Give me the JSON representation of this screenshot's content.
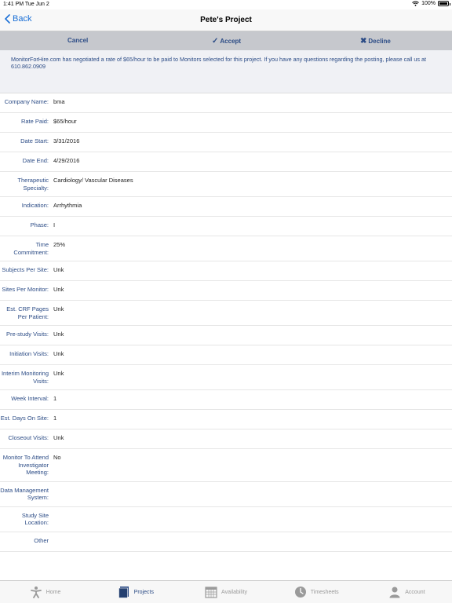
{
  "status_bar": {
    "time": "1:41 PM   Tue Jun 2",
    "battery": "100%",
    "battery_level": 1.0
  },
  "nav": {
    "back_label": "Back",
    "title": "Pete's Project"
  },
  "actions": {
    "cancel": "Cancel",
    "accept": "Accept",
    "decline": "Decline"
  },
  "notice": "MonitorForHire.com has negotiated a rate of $65/hour to be paid to Monitors selected for this project. If you have any questions regarding the posting, please call us at 610.862.0909",
  "details": [
    {
      "label": "Company Name:",
      "value": "bma"
    },
    {
      "label": "Rate Paid:",
      "value": "$65/hour"
    },
    {
      "label": "Date Start:",
      "value": "3/31/2016"
    },
    {
      "label": "Date End:",
      "value": "4/29/2016"
    },
    {
      "label": "Therapeutic Specialty:",
      "value": "Cardiology/ Vascular Diseases"
    },
    {
      "label": "Indication:",
      "value": "Arrhythmia"
    },
    {
      "label": "Phase:",
      "value": "I"
    },
    {
      "label": "Time Commitment:",
      "value": "25%"
    },
    {
      "label": "Subjects Per Site:",
      "value": "Unk"
    },
    {
      "label": "Sites Per Monitor:",
      "value": "Unk"
    },
    {
      "label": "Est. CRF Pages Per Patient:",
      "value": "Unk"
    },
    {
      "label": "Pre-study Visits:",
      "value": "Unk"
    },
    {
      "label": "Initiation Visits:",
      "value": "Unk"
    },
    {
      "label": "Interim Monitoring Visits:",
      "value": "Unk"
    },
    {
      "label": "Week Interval:",
      "value": "1"
    },
    {
      "label": "Est. Days On Site:",
      "value": "1"
    },
    {
      "label": "Closeout Visits:",
      "value": "Unk"
    },
    {
      "label": "Monitor To Attend Investigator Meeting:",
      "value": "No"
    },
    {
      "label": "Data Management System:",
      "value": ""
    },
    {
      "label": "Study Site Location:",
      "value": ""
    },
    {
      "label": "Other",
      "value": ""
    }
  ],
  "tabs": [
    {
      "label": "Home",
      "icon": "person-icon",
      "active": false
    },
    {
      "label": "Projects",
      "icon": "folder-icon",
      "active": true
    },
    {
      "label": "Availability",
      "icon": "calendar-icon",
      "active": false
    },
    {
      "label": "Timesheets",
      "icon": "clock-icon",
      "active": false
    },
    {
      "label": "Account",
      "icon": "user-icon",
      "active": false
    }
  ],
  "colors": {
    "accent": "#2c4c86",
    "link": "#1a6fd6",
    "action_bar": "#c6c8cd"
  }
}
